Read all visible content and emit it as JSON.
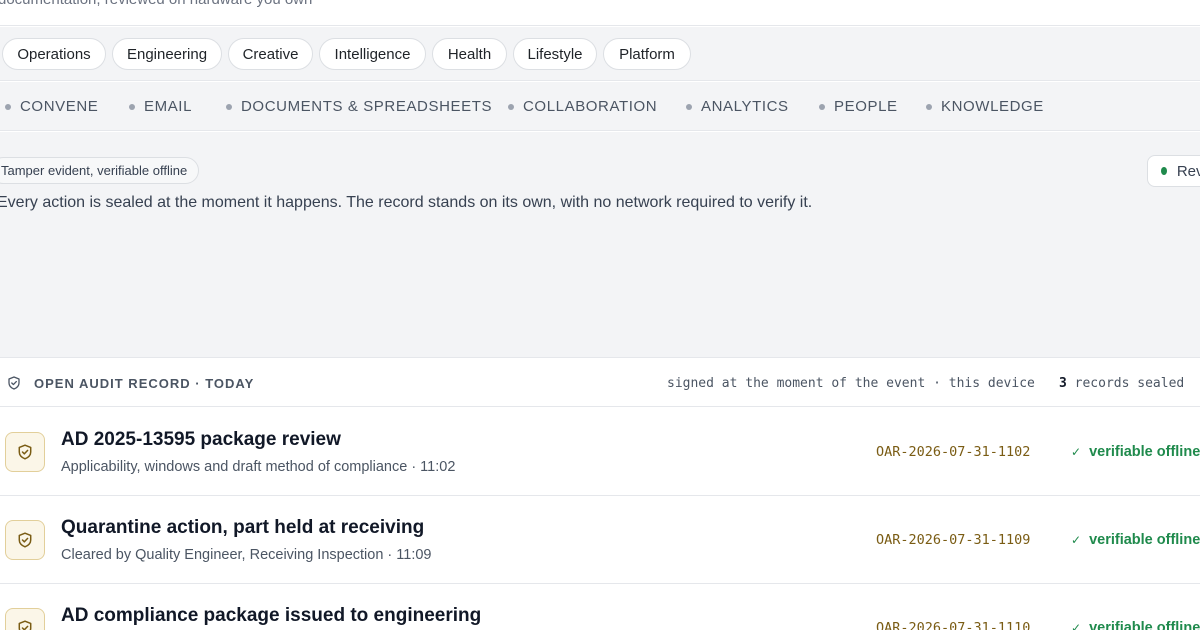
{
  "header": {
    "subtitle": "documentation, reviewed on hardware you own"
  },
  "categories": [
    {
      "label": "Operations"
    },
    {
      "label": "Engineering"
    },
    {
      "label": "Creative"
    },
    {
      "label": "Intelligence"
    },
    {
      "label": "Health"
    },
    {
      "label": "Lifestyle"
    },
    {
      "label": "Platform"
    }
  ],
  "modules": [
    {
      "label": "CONVENE"
    },
    {
      "label": "EMAIL"
    },
    {
      "label": "DOCUMENTS & SPREADSHEETS"
    },
    {
      "label": "COLLABORATION"
    },
    {
      "label": "ANALYTICS"
    },
    {
      "label": "PEOPLE"
    },
    {
      "label": "KNOWLEDGE"
    }
  ],
  "hero": {
    "pill": "Tamper evident, verifiable offline",
    "text": "Every action is sealed at the moment it happens. The record stands on its own, with no network required to verify it.",
    "badge": "Review"
  },
  "audit": {
    "title": "OPEN AUDIT RECORD · TODAY",
    "signing": "signed at the moment of the event · this device",
    "count": "3",
    "count_suffix": "records sealed",
    "records": [
      {
        "title": "AD 2025-13595 package review",
        "subtitle": "Applicability, windows and draft method of compliance · 11:02",
        "id": "OAR-2026-07-31-1102",
        "status": "verifiable offline"
      },
      {
        "title": "Quarantine action, part held at receiving",
        "subtitle": "Cleared by Quality Engineer, Receiving Inspection · 11:09",
        "id": "OAR-2026-07-31-1109",
        "status": "verifiable offline"
      },
      {
        "title": "AD compliance package issued to engineering",
        "subtitle": "",
        "id": "OAR-2026-07-31-1110",
        "status": "verifiable offline"
      }
    ]
  },
  "colors": {
    "accent_gold": "#7a5c14",
    "status_green": "#1f8a4c",
    "panel_gray": "#f3f4f6"
  },
  "icons": {
    "record": "shield-check-icon",
    "status": "check-icon",
    "header": "shield-icon"
  }
}
